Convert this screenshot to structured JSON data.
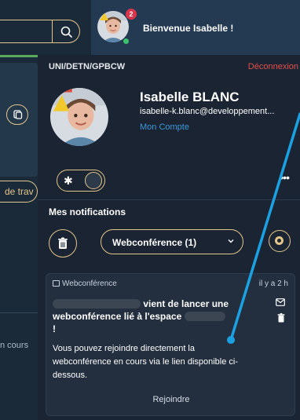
{
  "header": {
    "greeting": "Bienvenue Isabelle !",
    "notification_count": "2"
  },
  "background_app": {
    "search_placeholder": "",
    "chip_text": "de trav",
    "status_text": "n cours"
  },
  "panel": {
    "org_code": "UNI/DETN/GPBCW",
    "logout": "Déconnexion",
    "user_name": "Isabelle BLANC",
    "user_email": "isabelle-k.blanc@developpement...",
    "account_link": "Mon Compte",
    "notifications_title": "Mes notifications",
    "filter": {
      "selected": "Webconférence (1)"
    }
  },
  "notification": {
    "type": "Webconférence",
    "time": "il y a 2 h",
    "heading_line1": "vient de lancer une",
    "heading_line2": "webconférence lié à l'espace",
    "heading_line3": "!",
    "body": "Vous pouvez rejoindre directement la webconférence en cours via le lien disponible ci-dessous.",
    "action": "Rejoindre"
  },
  "colors": {
    "accent_gold": "#e3c68a",
    "logout_red": "#e0514a",
    "link_blue": "#3a98d8",
    "badge_red": "#d9344a",
    "panel_bg": "#1b2432",
    "annotation_blue": "#1ba1e2"
  }
}
